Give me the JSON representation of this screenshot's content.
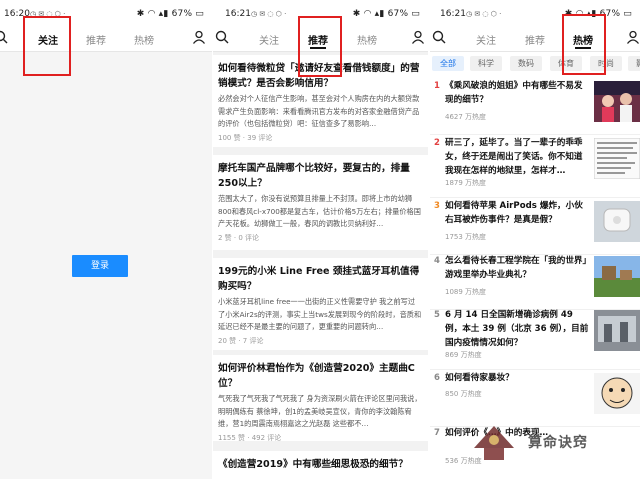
{
  "status": {
    "p1_time": "16:20",
    "p2_time": "16:21",
    "p3_time": "16:21",
    "battery": "67%"
  },
  "tabs": {
    "follow": "关注",
    "recommend": "推荐",
    "hot": "热榜"
  },
  "login": {
    "label": "登录"
  },
  "feed": [
    {
      "question": "如何看待微粒贷「邀请好友查看借钱额度」的营销模式？是否会影响信用？",
      "excerpt": "必然会对个人征信产生影响，甚至会对个人购房在内的大额贷款需求产生负面影响：来看看腾讯官方发布的对吝家金融借贷产品的评价（也包括微粒贷）吧：征信查多了易影响…",
      "meta": "100 赞 · 39 评论"
    },
    {
      "question": "摩托车国产品牌哪个比较好，要复古的，排量250以上？",
      "excerpt": "范围太大了，你没有说预算且排量上不封顶。即将上市的幼狮800和春风cl-x700都是复古车，估计价格5万左右；排量价格国产天花板。幼狮做工一般，春风的调教比贝纳利好…",
      "meta": "2 赞 · 0 评论"
    },
    {
      "question": "199元的小米 Line Free 颈挂式蓝牙耳机值得购买吗？",
      "excerpt": "小米蓝牙耳机line free一一出街的正义性需要守护 我之前写过了小米Air2s的评测，事实上当tws发展到现今的阶段时，音质和延迟已经不是最主要的问题了，更重要的问题转向…",
      "meta": "20 赞 · 7 评论"
    },
    {
      "question": "如何评价林君怡作为《创造营2020》主题曲C位？",
      "excerpt": "气死我了气死我了气死我了 身为资深刷火箭在评论区里问我说，明明偶练有 蔡徐坤，创1的孟美岐吴宣仪，青你的李汶翰陈宥维，营1的周震南焉栩嘉这之光赵磊 这些都不…",
      "meta": "1155 赞 · 492 评论"
    },
    {
      "question": "《创造营2019》中有哪些细思极恐的细节？",
      "excerpt": "",
      "meta": ""
    }
  ],
  "chips": [
    "全部",
    "科学",
    "数码",
    "体育",
    "时尚",
    "影"
  ],
  "hot": [
    {
      "rank": "1",
      "title": "《乘风破浪的姐姐》中有哪些不易发现的细节？",
      "heat": "4627 万热度"
    },
    {
      "rank": "2",
      "title": "研三了，延毕了。当了一辈子的乖乖女，终于还是闹出了笑话。你不知道我现在怎样的地狱里，怎样才…",
      "heat": "1879 万热度"
    },
    {
      "rank": "3",
      "title": "如何看待苹果 AirPods 爆炸，小伙右耳被炸伤事件？是真是假？",
      "heat": "1753 万热度"
    },
    {
      "rank": "4",
      "title": "怎么看待长春工程学院在「我的世界」游戏里举办毕业典礼？",
      "heat": "1089 万热度"
    },
    {
      "rank": "5",
      "title": "6 月 14 日全国新增确诊病例 49 例，本土 39 例（北京 36 例），目前国内疫情情况如何？",
      "heat": "869 万热度"
    },
    {
      "rank": "6",
      "title": "如何看待家暴妆？",
      "heat": "850 万热度"
    },
    {
      "rank": "7",
      "title": "如何评价《…》中的表现…",
      "heat": "536 万热度"
    }
  ],
  "watermark": {
    "text": "算命诀窍"
  }
}
